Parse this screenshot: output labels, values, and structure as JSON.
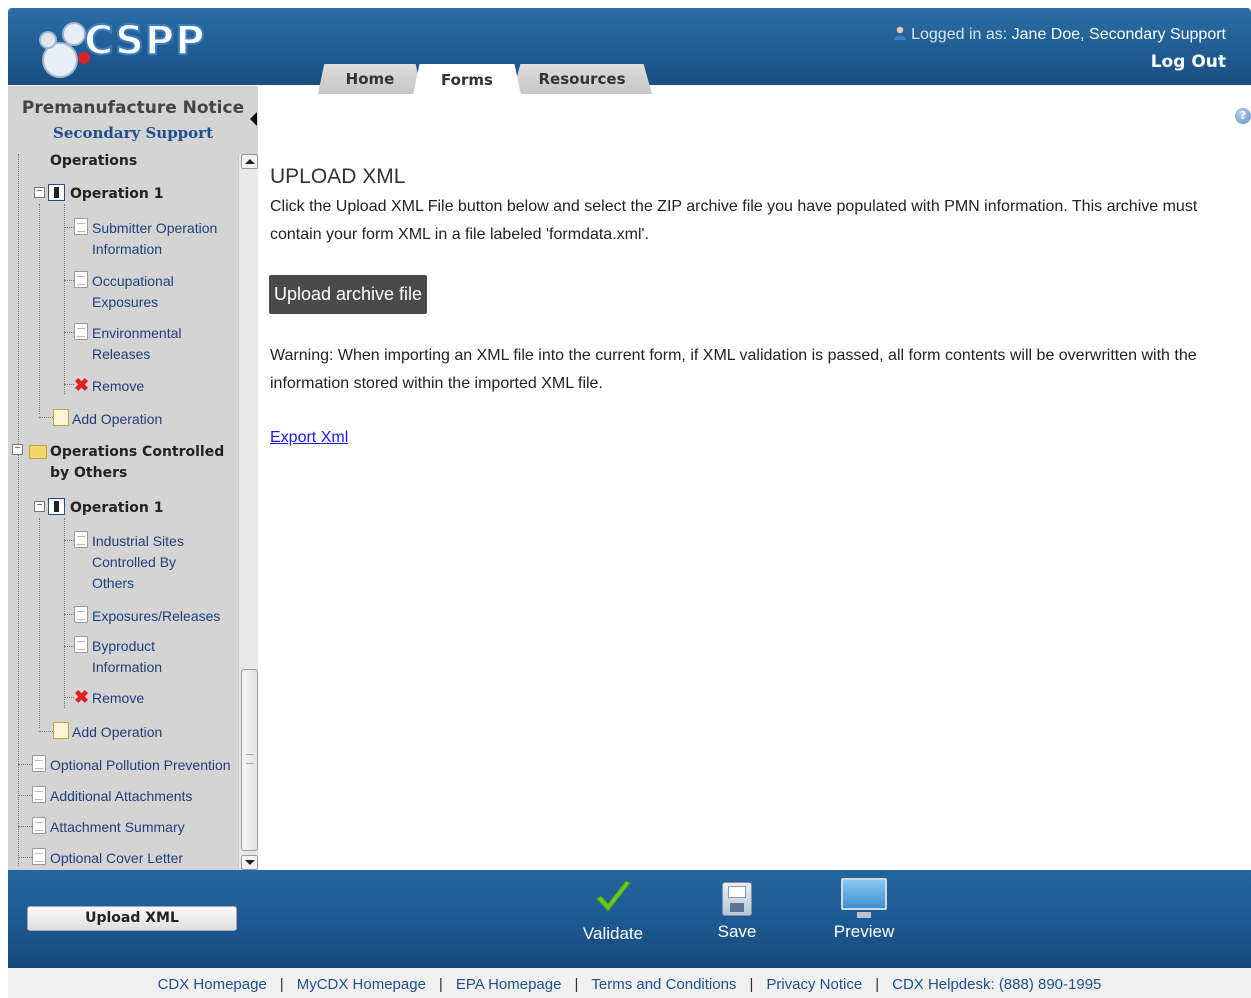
{
  "header": {
    "logo_text": "CSPP",
    "login_prefix": "Logged in as:",
    "login_user": "Jane Doe, Secondary Support",
    "logout_label": "Log Out",
    "tabs": [
      {
        "label": "Home",
        "active": false
      },
      {
        "label": "Forms",
        "active": true
      },
      {
        "label": "Resources",
        "active": false
      }
    ]
  },
  "sidebar": {
    "title": "Premanufacture Notice",
    "subtitle": "Secondary Support",
    "tree": {
      "operations_header": "Operations",
      "op1_label": "Operation 1",
      "op1_items": [
        "Submitter Operation Information",
        "Occupational Exposures",
        "Environmental Releases"
      ],
      "remove_label": "Remove",
      "add_operation_label": "Add Operation",
      "controlled_header": "Operations Controlled by Others",
      "ctrl_op1_label": "Operation 1",
      "ctrl_op1_items": [
        "Industrial Sites Controlled By Others",
        "Exposures/Releases",
        "Byproduct Information"
      ],
      "bottom_items": [
        "Optional Pollution Prevention",
        "Additional Attachments",
        "Attachment Summary",
        "Optional Cover Letter"
      ]
    }
  },
  "main": {
    "heading": "UPLOAD XML",
    "intro": "Click the Upload XML File button below and select the ZIP archive file you have populated with PMN information. This archive must contain your form XML in a file labeled 'formdata.xml'.",
    "upload_button": "Upload archive file",
    "warning": "Warning: When importing an XML file into the current form, if XML validation is passed, all form contents will be overwritten with the information stored within the imported XML file.",
    "export_link": "Export Xml",
    "help_icon": "?"
  },
  "bottom_bar": {
    "upload_xml_button": "Upload XML",
    "actions": {
      "validate": "Validate",
      "save": "Save",
      "preview": "Preview"
    }
  },
  "footer": {
    "links": [
      "CDX Homepage",
      "MyCDX Homepage",
      "EPA Homepage",
      "Terms and Conditions",
      "Privacy Notice",
      "CDX Helpdesk: (888) 890-1995"
    ]
  },
  "colors": {
    "header_blue": "#1f5c93",
    "link_blue": "#1f4f8c",
    "sidebar_gray": "#d4d4d4",
    "remove_red": "#e02020",
    "validate_green": "#6cc72a"
  }
}
